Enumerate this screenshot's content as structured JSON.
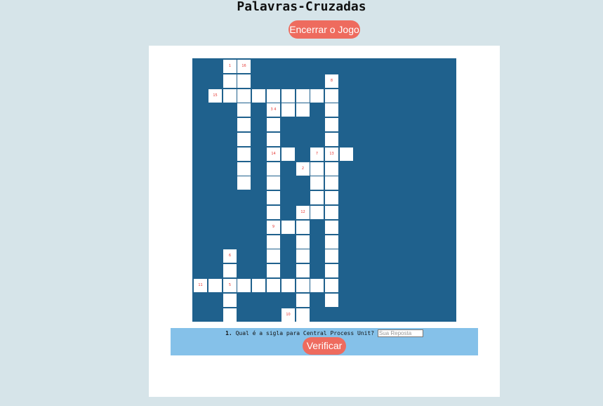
{
  "title": "Palavras-Cruzadas",
  "end_button": "Encerrar o Jogo",
  "colors": {
    "page_bg": "#d6e4e9",
    "board": "#1f618d",
    "button": "#ee6b5e",
    "clue_bar": "#85c1e9",
    "number": "#e53935"
  },
  "grid": {
    "rows": 18,
    "cols": 18,
    "cells": [
      [
        0,
        2
      ],
      [
        0,
        3
      ],
      [
        1,
        2
      ],
      [
        1,
        3
      ],
      [
        1,
        9
      ],
      [
        2,
        1
      ],
      [
        2,
        2
      ],
      [
        2,
        3
      ],
      [
        2,
        4
      ],
      [
        2,
        5
      ],
      [
        2,
        6
      ],
      [
        2,
        7
      ],
      [
        2,
        8
      ],
      [
        2,
        9
      ],
      [
        3,
        3
      ],
      [
        3,
        5
      ],
      [
        3,
        6
      ],
      [
        3,
        7
      ],
      [
        3,
        9
      ],
      [
        4,
        3
      ],
      [
        4,
        5
      ],
      [
        4,
        9
      ],
      [
        5,
        3
      ],
      [
        5,
        5
      ],
      [
        5,
        9
      ],
      [
        6,
        3
      ],
      [
        6,
        5
      ],
      [
        6,
        6
      ],
      [
        6,
        8
      ],
      [
        6,
        9
      ],
      [
        6,
        10
      ],
      [
        7,
        3
      ],
      [
        7,
        5
      ],
      [
        7,
        7
      ],
      [
        7,
        8
      ],
      [
        7,
        9
      ],
      [
        8,
        3
      ],
      [
        8,
        5
      ],
      [
        8,
        8
      ],
      [
        8,
        9
      ],
      [
        9,
        5
      ],
      [
        9,
        8
      ],
      [
        9,
        9
      ],
      [
        10,
        5
      ],
      [
        10,
        7
      ],
      [
        10,
        8
      ],
      [
        10,
        9
      ],
      [
        11,
        5
      ],
      [
        11,
        6
      ],
      [
        11,
        7
      ],
      [
        11,
        9
      ],
      [
        12,
        5
      ],
      [
        12,
        7
      ],
      [
        12,
        9
      ],
      [
        13,
        2
      ],
      [
        13,
        5
      ],
      [
        13,
        7
      ],
      [
        13,
        9
      ],
      [
        14,
        2
      ],
      [
        14,
        5
      ],
      [
        14,
        7
      ],
      [
        14,
        9
      ],
      [
        15,
        0
      ],
      [
        15,
        1
      ],
      [
        15,
        2
      ],
      [
        15,
        3
      ],
      [
        15,
        4
      ],
      [
        15,
        5
      ],
      [
        15,
        6
      ],
      [
        15,
        7
      ],
      [
        15,
        8
      ],
      [
        15,
        9
      ],
      [
        16,
        2
      ],
      [
        16,
        7
      ],
      [
        16,
        9
      ],
      [
        17,
        2
      ],
      [
        17,
        6
      ],
      [
        17,
        7
      ]
    ],
    "numbers": [
      {
        "r": 0,
        "c": 2,
        "n": "1"
      },
      {
        "r": 0,
        "c": 3,
        "n": "16"
      },
      {
        "r": 1,
        "c": 9,
        "n": "8"
      },
      {
        "r": 2,
        "c": 1,
        "n": "15"
      },
      {
        "r": 3,
        "c": 5,
        "n": "3 4"
      },
      {
        "r": 6,
        "c": 5,
        "n": "14"
      },
      {
        "r": 6,
        "c": 8,
        "n": "7"
      },
      {
        "r": 6,
        "c": 9,
        "n": "13"
      },
      {
        "r": 7,
        "c": 7,
        "n": "2"
      },
      {
        "r": 10,
        "c": 7,
        "n": "12"
      },
      {
        "r": 11,
        "c": 5,
        "n": "9"
      },
      {
        "r": 13,
        "c": 2,
        "n": "6"
      },
      {
        "r": 15,
        "c": 0,
        "n": "11"
      },
      {
        "r": 15,
        "c": 2,
        "n": "5"
      },
      {
        "r": 17,
        "c": 6,
        "n": "10"
      }
    ]
  },
  "clue": {
    "number": "1.",
    "text": "Qual é a sigla para Central Process Unit?",
    "placeholder": "Sua Reposta"
  },
  "verify_button": "Verificar"
}
